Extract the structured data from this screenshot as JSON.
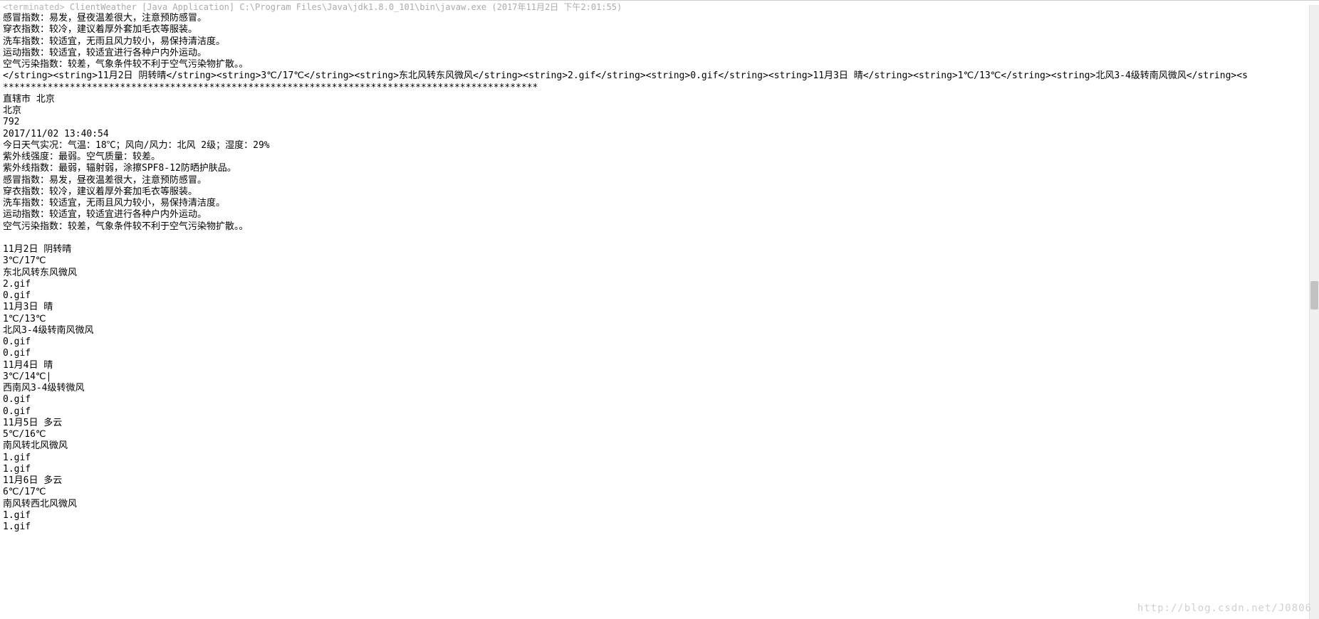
{
  "header": {
    "terminated": "<terminated>",
    "appName": "ClientWeather [Java Application]",
    "jrePath": "C:\\Program Files\\Java\\jdk1.8.0_101\\bin\\javaw.exe",
    "timestamp": "(2017年11月2日 下午2:01:55)"
  },
  "topIndices": {
    "line1": "感冒指数：易发，昼夜温差很大，注意预防感冒。",
    "line2": "穿衣指数：较冷，建议着厚外套加毛衣等服装。",
    "line3": "洗车指数：较适宜，无雨且风力较小，易保持清洁度。",
    "line4": "运动指数：较适宜，较适宜进行各种户内外运动。",
    "line5": "空气污染指数：较差，气象条件较不利于空气污染物扩散。。"
  },
  "xmlLine": "</string><string>11月2日 阴转晴</string><string>3℃/17℃</string><string>东北风转东风微风</string><string>2.gif</string><string>0.gif</string><string>11月3日 晴</string><string>1℃/13℃</string><string>北风3-4级转南风微风</string><s",
  "separator": "************************************************************************************************",
  "cityLine": "直辖市 北京",
  "cityName": "北京",
  "cityCode": "792",
  "datetime": "2017/11/02 13:40:54",
  "todayRealtime": "今日天气实况：气温：18℃；风向/风力：北风 2级；湿度：29%",
  "uvLine": "紫外线强度：最弱。空气质量：较差。",
  "uvIndex": "紫外线指数：最弱，辐射弱，涂擦SPF8-12防晒护肤品。",
  "coldIndex": "感冒指数：易发，昼夜温差很大，注意预防感冒。",
  "dressIndex": "穿衣指数：较冷，建议着厚外套加毛衣等服装。",
  "washIndex": "洗车指数：较适宜，无雨且风力较小，易保持清洁度。",
  "sportIndex": "运动指数：较适宜，较适宜进行各种户内外运动。",
  "airIndex": "空气污染指数：较差，气象条件较不利于空气污染物扩散。。",
  "forecast": {
    "d1_date": "11月2日 阴转晴",
    "d1_temp": "3℃/17℃",
    "d1_wind": "东北风转东风微风",
    "d1_gif1": "2.gif",
    "d1_gif2": "0.gif",
    "d2_date": "11月3日 晴",
    "d2_temp": "1℃/13℃",
    "d2_wind": "北风3-4级转南风微风",
    "d2_gif1": "0.gif",
    "d2_gif2": "0.gif",
    "d3_date": "11月4日 晴",
    "d3_temp": "3℃/14℃|",
    "d3_wind": "西南风3-4级转微风",
    "d3_gif1": "0.gif",
    "d3_gif2": "0.gif",
    "d4_date": "11月5日 多云",
    "d4_temp": "5℃/16℃",
    "d4_wind": "南风转北风微风",
    "d4_gif1": "1.gif",
    "d4_gif2": "1.gif",
    "d5_date": "11月6日 多云",
    "d5_temp": "6℃/17℃",
    "d5_wind": "南风转西北风微风",
    "d5_gif1": "1.gif",
    "d5_gif2": "1.gif"
  },
  "watermark": "http://blog.csdn.net/J0806"
}
